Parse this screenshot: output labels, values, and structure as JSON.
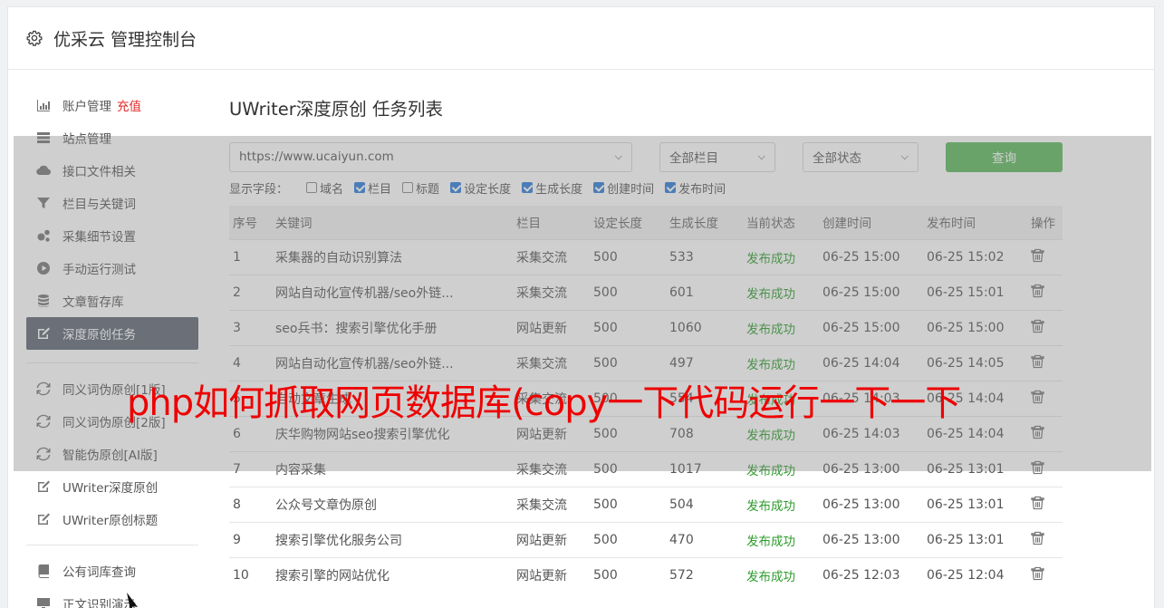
{
  "app": {
    "title": "优采云 管理控制台"
  },
  "sidebar": {
    "items": [
      {
        "label": "账户管理",
        "extra": "充值",
        "icon": "bar-chart-icon"
      },
      {
        "label": "站点管理",
        "icon": "server-icon"
      },
      {
        "label": "接口文件相关",
        "icon": "cloud-upload-icon"
      },
      {
        "label": "栏目与关键词",
        "icon": "filter-icon"
      },
      {
        "label": "采集细节设置",
        "icon": "gears-icon"
      },
      {
        "label": "手动运行测试",
        "icon": "play-icon"
      },
      {
        "label": "文章暂存库",
        "icon": "database-icon"
      },
      {
        "label": "深度原创任务",
        "icon": "edit-icon",
        "active": true
      }
    ],
    "items2": [
      {
        "label": "同义词伪原创[1版]",
        "icon": "refresh-icon"
      },
      {
        "label": "同义词伪原创[2版]",
        "icon": "refresh-icon"
      },
      {
        "label": "智能伪原创[AI版]",
        "icon": "refresh-icon"
      },
      {
        "label": "UWriter深度原创",
        "icon": "edit-icon"
      },
      {
        "label": "UWriter原创标题",
        "icon": "edit-icon"
      }
    ],
    "items3": [
      {
        "label": "公有词库查询",
        "icon": "book-icon"
      },
      {
        "label": "正文识别演示",
        "icon": "monitor-icon"
      }
    ]
  },
  "main": {
    "title": "UWriter深度原创 任务列表",
    "site_select": "https://www.ucaiyun.com",
    "column_select": "全部栏目",
    "status_select": "全部状态",
    "query_label": "查询",
    "fields_label": "显示字段：",
    "fields": [
      {
        "label": "域名",
        "checked": false
      },
      {
        "label": "栏目",
        "checked": true
      },
      {
        "label": "标题",
        "checked": false
      },
      {
        "label": "设定长度",
        "checked": true
      },
      {
        "label": "生成长度",
        "checked": true
      },
      {
        "label": "创建时间",
        "checked": true
      },
      {
        "label": "发布时间",
        "checked": true
      }
    ],
    "table": {
      "headers": [
        "序号",
        "关键词",
        "栏目",
        "设定长度",
        "生成长度",
        "当前状态",
        "创建时间",
        "发布时间",
        "操作"
      ],
      "rows": [
        [
          "1",
          "采集器的自动识别算法",
          "采集交流",
          "500",
          "533",
          "发布成功",
          "06-25 15:00",
          "06-25 15:02"
        ],
        [
          "2",
          "网站自动化宣传机器/seo外链...",
          "采集交流",
          "500",
          "601",
          "发布成功",
          "06-25 15:00",
          "06-25 15:01"
        ],
        [
          "3",
          "seo兵书：搜索引擎优化手册",
          "网站更新",
          "500",
          "1060",
          "发布成功",
          "06-25 15:00",
          "06-25 15:00"
        ],
        [
          "4",
          "网站自动化宣传机器/seo外链...",
          "采集交流",
          "500",
          "497",
          "发布成功",
          "06-25 14:04",
          "06-25 14:05"
        ],
        [
          "5",
          "自动文章生成",
          "采集交流",
          "500",
          "554",
          "发布成功",
          "06-25 14:03",
          "06-25 14:04"
        ],
        [
          "6",
          "庆华购物网站seo搜索引擎优化",
          "网站更新",
          "500",
          "708",
          "发布成功",
          "06-25 14:03",
          "06-25 14:04"
        ],
        [
          "7",
          "内容采集",
          "采集交流",
          "500",
          "1017",
          "发布成功",
          "06-25 13:00",
          "06-25 13:01"
        ],
        [
          "8",
          "公众号文章伪原创",
          "采集交流",
          "500",
          "504",
          "发布成功",
          "06-25 13:00",
          "06-25 13:01"
        ],
        [
          "9",
          "搜索引擎优化服务公司",
          "网站更新",
          "500",
          "470",
          "发布成功",
          "06-25 13:00",
          "06-25 13:01"
        ],
        [
          "10",
          "搜索引擎的网站优化",
          "网站更新",
          "500",
          "572",
          "发布成功",
          "06-25 12:03",
          "06-25 12:04"
        ]
      ]
    }
  },
  "watermark": "php如何抓取网页数据库(copy一下代码运行一下一下"
}
